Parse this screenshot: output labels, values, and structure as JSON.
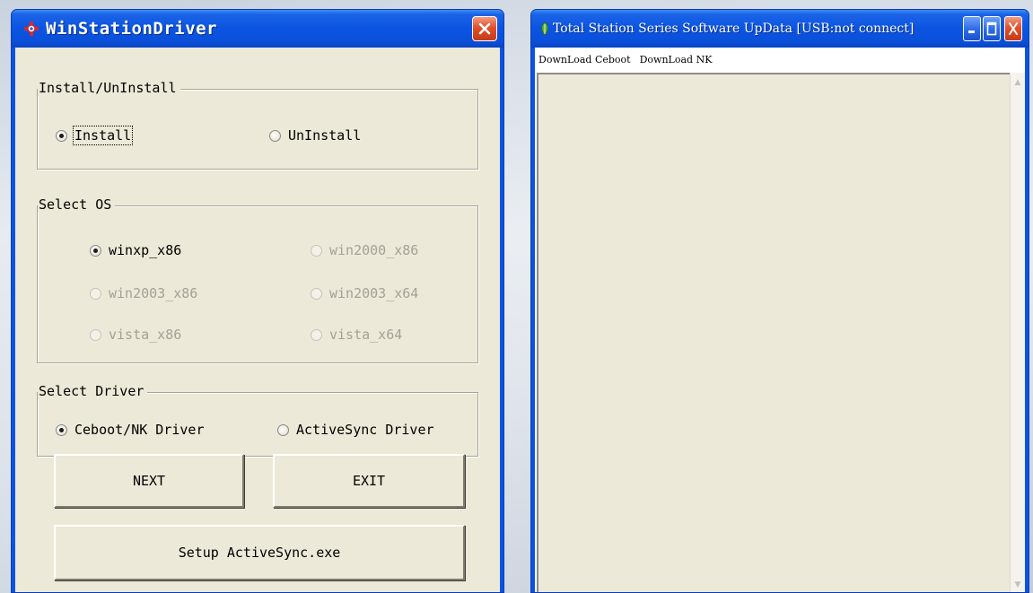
{
  "driver_window": {
    "title": "WinStationDriver",
    "install_group": {
      "title": "Install/UnInstall",
      "options": [
        {
          "label": "Install",
          "checked": true,
          "enabled": true
        },
        {
          "label": "UnInstall",
          "checked": false,
          "enabled": true
        }
      ]
    },
    "os_group": {
      "title": "Select OS",
      "options": [
        {
          "label": "winxp_x86",
          "checked": true,
          "enabled": true
        },
        {
          "label": "win2000_x86",
          "checked": false,
          "enabled": false
        },
        {
          "label": "win2003_x86",
          "checked": false,
          "enabled": false
        },
        {
          "label": "win2003_x64",
          "checked": false,
          "enabled": false
        },
        {
          "label": "vista_x86",
          "checked": false,
          "enabled": false
        },
        {
          "label": "vista_x64",
          "checked": false,
          "enabled": false
        }
      ]
    },
    "driver_group": {
      "title": "Select Driver",
      "options": [
        {
          "label": "Ceboot/NK Driver",
          "checked": true,
          "enabled": true
        },
        {
          "label": "ActiveSync Driver",
          "checked": false,
          "enabled": true
        }
      ]
    },
    "buttons": {
      "next": "NEXT",
      "exit": "EXIT",
      "setup": "Setup ActiveSync.exe"
    }
  },
  "update_window": {
    "title": "Total Station Series Software UpData [USB:not connect]",
    "menu": [
      "DownLoad Ceboot",
      "DownLoad NK"
    ]
  },
  "colors": {
    "titlebar": "#0b54e2",
    "dialog_face": "#ece9d8",
    "close_button": "#e0512c",
    "disabled_text": "#a3a197"
  },
  "icons": {
    "driver_app": "station-driver-icon",
    "update_app": "leaf-app-icon",
    "close": "close-icon",
    "minimize": "minimize-icon",
    "maximize": "maximize-icon"
  }
}
